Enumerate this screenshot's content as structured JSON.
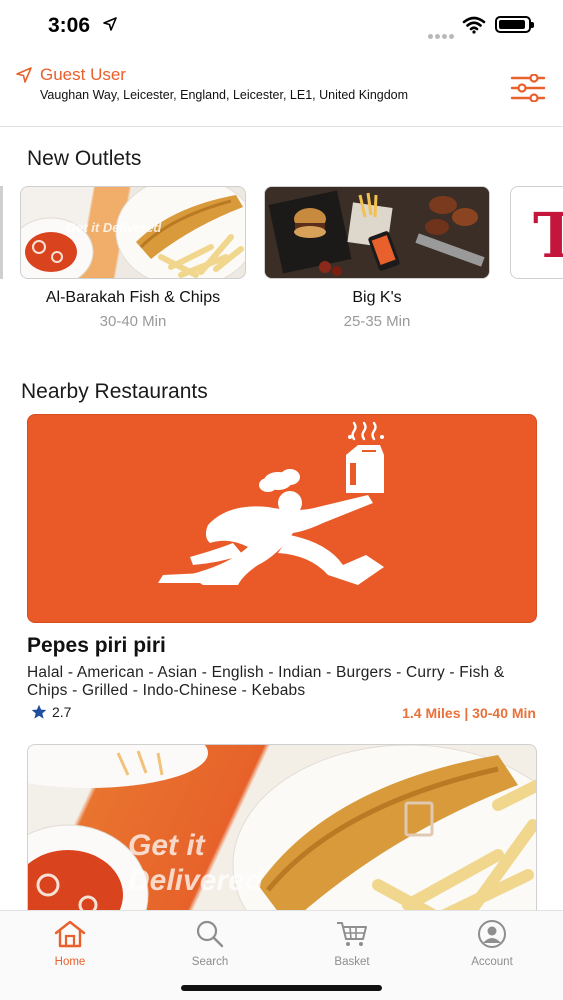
{
  "status_bar": {
    "time": "3:06"
  },
  "header": {
    "user_label": "Guest User",
    "address": "Vaughan Way, Leicester, England, Leicester, LE1, United Kingdom",
    "location_icon": "location-arrow-icon",
    "filter_icon": "sliders-icon"
  },
  "new_outlets": {
    "title": "New Outlets",
    "items": [
      {
        "name": "Al-Barakah Fish & Chips",
        "time": "30-40 Min",
        "image_text": "Get it Delivered"
      },
      {
        "name": "Big K's",
        "time": "25-35 Min"
      }
    ],
    "peek_letter": "T"
  },
  "nearby": {
    "title": "Nearby Restaurants",
    "restaurants": [
      {
        "name": "Pepes piri piri",
        "cuisines": "Halal - American - Asian - English - Indian - Burgers - Curry - Fish & Chips - Grilled - Indo-Chinese - Kebabs",
        "rating": "2.7",
        "meta": "1.4 Miles | 30-40 Min"
      },
      {
        "image_text_1": "Get it",
        "image_text_2": "Delivered"
      }
    ]
  },
  "tabs": [
    {
      "label": "Home",
      "icon": "home-icon",
      "active": true
    },
    {
      "label": "Search",
      "icon": "search-icon",
      "active": false
    },
    {
      "label": "Basket",
      "icon": "basket-icon",
      "active": false
    },
    {
      "label": "Account",
      "icon": "account-icon",
      "active": false
    }
  ],
  "colors": {
    "accent": "#e8602c",
    "banner": "#e95a28",
    "meta": "#e8713a",
    "star": "#1f4e9c"
  }
}
